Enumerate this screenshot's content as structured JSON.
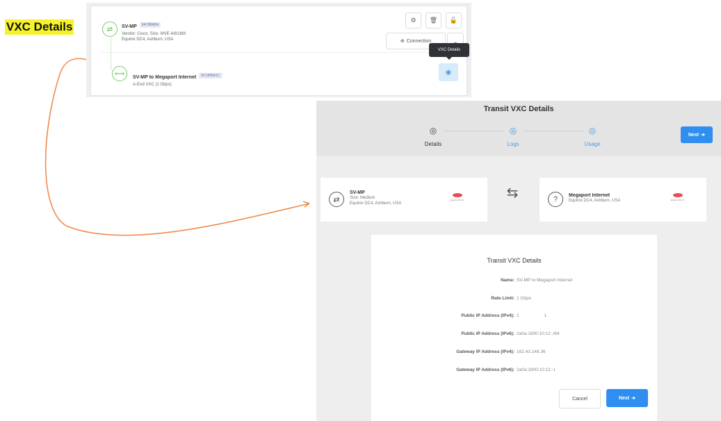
{
  "annotation": {
    "label": "VXC Details",
    "highlight_color": "#f6f22a",
    "arrow_color": "#f08a4b"
  },
  "service_card": {
    "port": {
      "name": "SV-MP",
      "id_tag": "8A7B8AB4",
      "line1": "Vendor: Cisco, Size: MVE 4/8/16M",
      "line2": "Equinix DC4, Ashburn, USA",
      "icon": "port-icon"
    },
    "actions": {
      "settings_icon": "gear-icon",
      "delete_icon": "trash-icon",
      "lock_icon": "lock-icon",
      "connection_label": "Connection",
      "collapse_icon": "chevron-up-icon"
    },
    "vxc": {
      "name": "SV-MP to Megaport Internet",
      "id_tag": "8C1888A1C",
      "line1": "A-End VXC (1 Gbps)",
      "icon": "vxc-icon"
    },
    "tooltip": "VXC Details",
    "details_button_icon": "eye-icon"
  },
  "panel": {
    "title": "Transit VXC Details",
    "steps": [
      {
        "label": "Details",
        "icon": "eye-icon",
        "active": true
      },
      {
        "label": "Logs",
        "icon": "eye-icon",
        "active": false
      },
      {
        "label": "Usage",
        "icon": "eye-icon",
        "active": false
      }
    ],
    "next_label": "Next",
    "a_end": {
      "name": "SV-MP",
      "line1": "Size: Medium",
      "line2": "Equinix DC4, Ashburn, USA",
      "logo": "EQUINIX"
    },
    "b_end": {
      "name": "Megaport Internet",
      "line1": "Equinix DC4, Ashburn, USA",
      "logo": "EQUINIX"
    },
    "swap_icon": "swap-arrows-icon",
    "details": {
      "title": "Transit VXC Details",
      "rows": [
        {
          "key": "Name:",
          "value": "SV-MP to Megaport Internet"
        },
        {
          "key": "Rate Limit:",
          "value": "1 Gbps"
        },
        {
          "key": "Public IP Address (IPv4):",
          "value": "1                    1"
        },
        {
          "key": "Public IP Address (IPv6):",
          "value": "2a0a:1800:10:12::/64"
        },
        {
          "key": "Gateway IP Address (IPv4):",
          "value": "162.43.148.36"
        },
        {
          "key": "Gateway IP Address (IPv6):",
          "value": "2a0a:1800:10:12::1"
        }
      ],
      "cancel_label": "Cancel",
      "next_label": "Next"
    }
  },
  "colors": {
    "accent": "#2f8ef0",
    "green": "#6bbf5c",
    "equinix_red": "#e84c57"
  }
}
